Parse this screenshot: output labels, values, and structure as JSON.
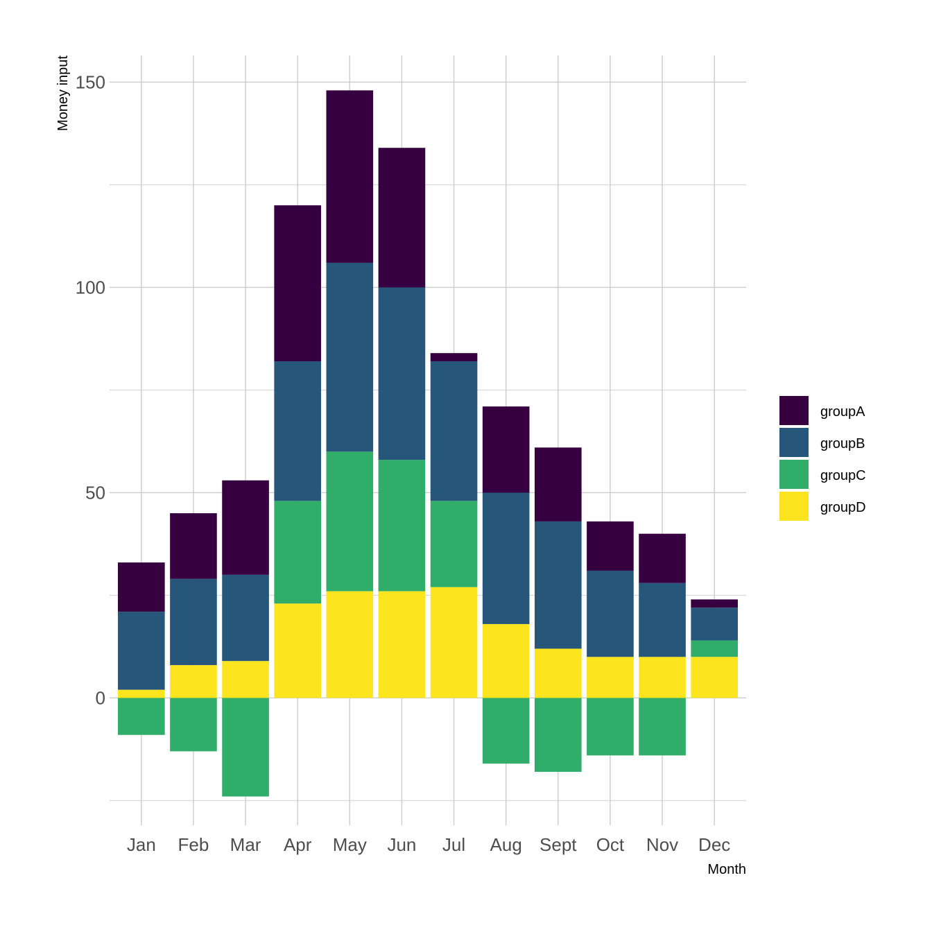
{
  "chart_data": {
    "type": "bar",
    "stacked": true,
    "title": "",
    "xlabel": "Month",
    "ylabel": "Money input",
    "categories": [
      "Jan",
      "Feb",
      "Mar",
      "Apr",
      "May",
      "Jun",
      "Jul",
      "Aug",
      "Sept",
      "Oct",
      "Nov",
      "Dec"
    ],
    "series": [
      {
        "name": "groupA",
        "color": "#360040",
        "values": [
          12,
          16,
          23,
          38,
          42,
          34,
          2,
          21,
          18,
          12,
          12,
          2
        ]
      },
      {
        "name": "groupB",
        "color": "#27567B",
        "values": [
          19,
          21,
          21,
          34,
          46,
          42,
          34,
          32,
          31,
          21,
          18,
          8
        ]
      },
      {
        "name": "groupC",
        "color": "#2FAD69",
        "values": [
          -9,
          -13,
          -24,
          25,
          34,
          32,
          21,
          -16,
          -18,
          -14,
          -14,
          4
        ]
      },
      {
        "name": "groupD",
        "color": "#FCE51E",
        "values": [
          2,
          8,
          9,
          23,
          26,
          26,
          27,
          18,
          12,
          10,
          10,
          10
        ]
      }
    ],
    "stack_order_bottom_to_top": [
      "groupD",
      "groupC",
      "groupB",
      "groupA"
    ],
    "ylim": [
      -31,
      156.5
    ],
    "yticks": [
      0,
      50,
      100,
      150
    ],
    "ytick_labels": [
      "0",
      "50",
      "100",
      "150"
    ],
    "minor_gridlines": [
      -25,
      25,
      75,
      125
    ],
    "grid": true,
    "legend_position": "right"
  }
}
